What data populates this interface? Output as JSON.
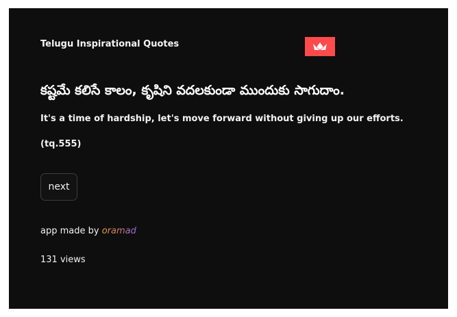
{
  "app": {
    "title": "Telugu Inspirational Quotes",
    "logo_icon": "crown-icon",
    "accent_color": "#ff4b4b",
    "background_color": "#0e0e0e"
  },
  "quote": {
    "telugu": "కష్టమే కలిసే కాలం, కృషిని వదలకుండా ముందుకు సాగుదాం.",
    "english": "It's a time of hardship, let's move forward without giving up our efforts.",
    "reference": "(tq.555)"
  },
  "controls": {
    "next_label": "next"
  },
  "footer": {
    "credit_prefix": "app made by ",
    "author": "oramad",
    "views": "131 views"
  }
}
